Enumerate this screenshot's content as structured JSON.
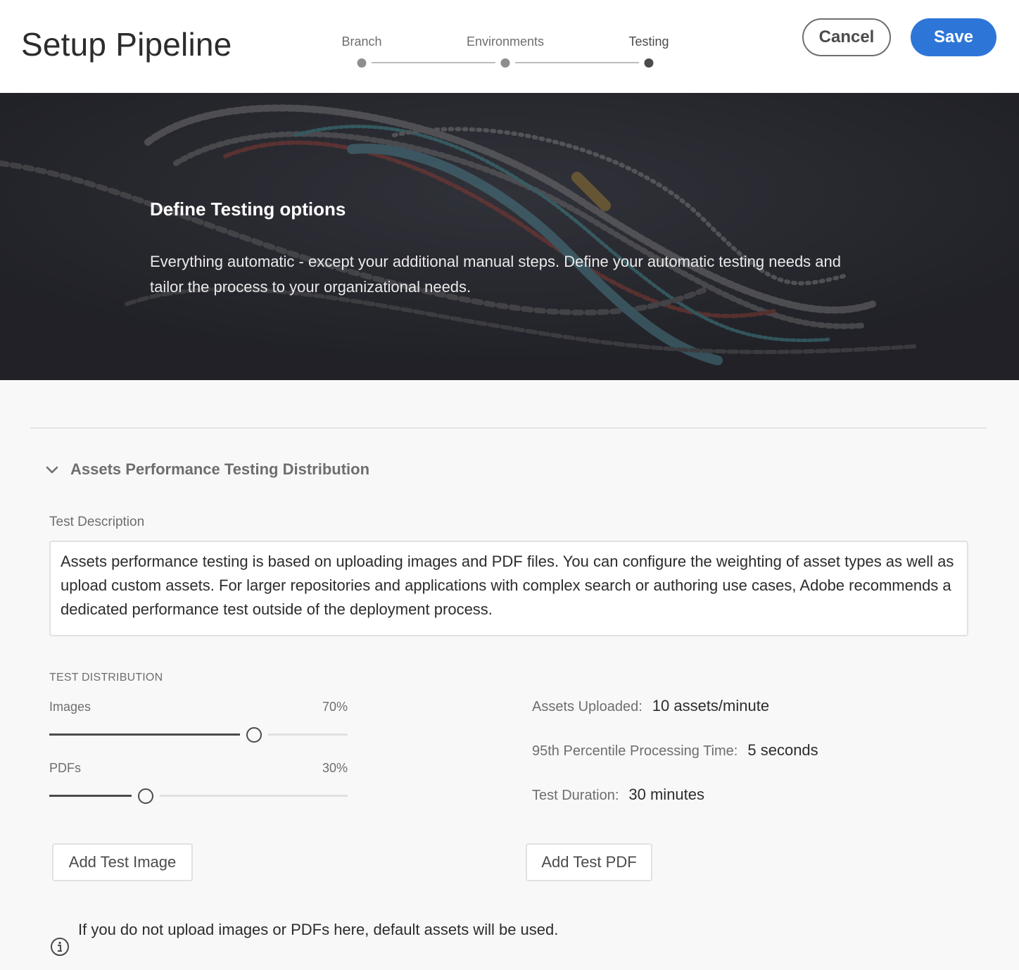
{
  "header": {
    "title": "Setup Pipeline",
    "steps": [
      {
        "label": "Branch",
        "state": "done"
      },
      {
        "label": "Environments",
        "state": "done"
      },
      {
        "label": "Testing",
        "state": "active"
      }
    ],
    "cancel_label": "Cancel",
    "save_label": "Save"
  },
  "hero": {
    "title": "Define Testing options",
    "description": "Everything automatic - except your additional manual steps. Define your automatic testing needs and tailor the process to your organizational needs."
  },
  "section": {
    "title": "Assets Performance Testing Distribution",
    "expanded": true,
    "description_label": "Test Description",
    "description_text": "Assets performance testing is based on uploading images and PDF files. You can configure the weighting of asset types as well as upload custom assets. For larger repositories and applications with complex search or authoring use cases, Adobe recommends a dedicated performance test outside of the deployment process.",
    "distribution_heading": "TEST DISTRIBUTION",
    "sliders": [
      {
        "label": "Images",
        "value_text": "70%",
        "value": 0.7
      },
      {
        "label": "PDFs",
        "value_text": "30%",
        "value": 0.3
      }
    ],
    "stats": [
      {
        "label": "Assets Uploaded:",
        "value": "10 assets/minute"
      },
      {
        "label": "95th Percentile Processing Time:",
        "value": "5 seconds"
      },
      {
        "label": "Test Duration:",
        "value": "30 minutes"
      }
    ],
    "add_image_label": "Add Test Image",
    "add_pdf_label": "Add Test PDF",
    "info_text": "If you do not upload images or PDFs here, default assets will be used."
  },
  "colors": {
    "accent": "#2d76d8",
    "hero_background": "#2a2b32"
  }
}
